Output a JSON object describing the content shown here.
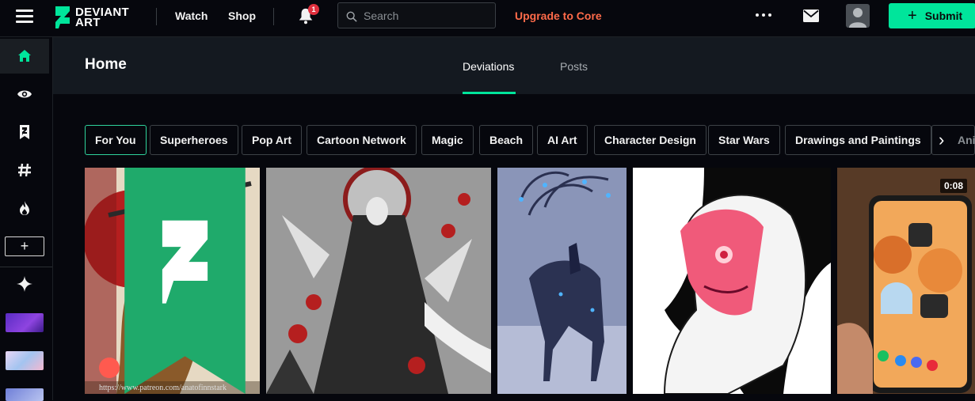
{
  "brand": {
    "line1": "DEVIANT",
    "line2": "ART"
  },
  "nav": {
    "watch": "Watch",
    "shop": "Shop",
    "upgrade": "Upgrade to Core"
  },
  "notifications": {
    "count": "1"
  },
  "search": {
    "placeholder": "Search",
    "value": ""
  },
  "submit": {
    "label": "Submit"
  },
  "page": {
    "title": "Home"
  },
  "tabs": [
    {
      "label": "Deviations",
      "active": true
    },
    {
      "label": "Posts",
      "active": false
    }
  ],
  "chips": [
    {
      "label": "For You",
      "active": true
    },
    {
      "label": "Superheroes"
    },
    {
      "label": "Pop Art"
    },
    {
      "label": "Cartoon Network"
    },
    {
      "label": "Magic"
    },
    {
      "label": "Beach"
    },
    {
      "label": "AI Art"
    },
    {
      "label": "Character Design"
    },
    {
      "label": "Star Wars"
    },
    {
      "label": "Drawings and Paintings"
    },
    {
      "label": "Anime"
    }
  ],
  "sidebar": {
    "items": [
      {
        "icon": "home-icon",
        "active": true
      },
      {
        "icon": "eye-icon"
      },
      {
        "icon": "deviantart-icon"
      },
      {
        "icon": "hashtag-icon"
      },
      {
        "icon": "fire-icon"
      }
    ],
    "add_label": "+",
    "sparkle_icon": "sparkle-icon"
  },
  "artworks": [
    {
      "kind": "illustration",
      "caption": "https://www.patreon.com/anatofinnstark"
    },
    {
      "kind": "illustration"
    },
    {
      "kind": "illustration"
    },
    {
      "kind": "illustration"
    },
    {
      "kind": "video",
      "duration": "0:08"
    }
  ],
  "colors": {
    "accent": "#00e59b",
    "upgrade": "#ff6b4a",
    "badge": "#e0303e",
    "background": "#06070d",
    "header": "#141920"
  }
}
